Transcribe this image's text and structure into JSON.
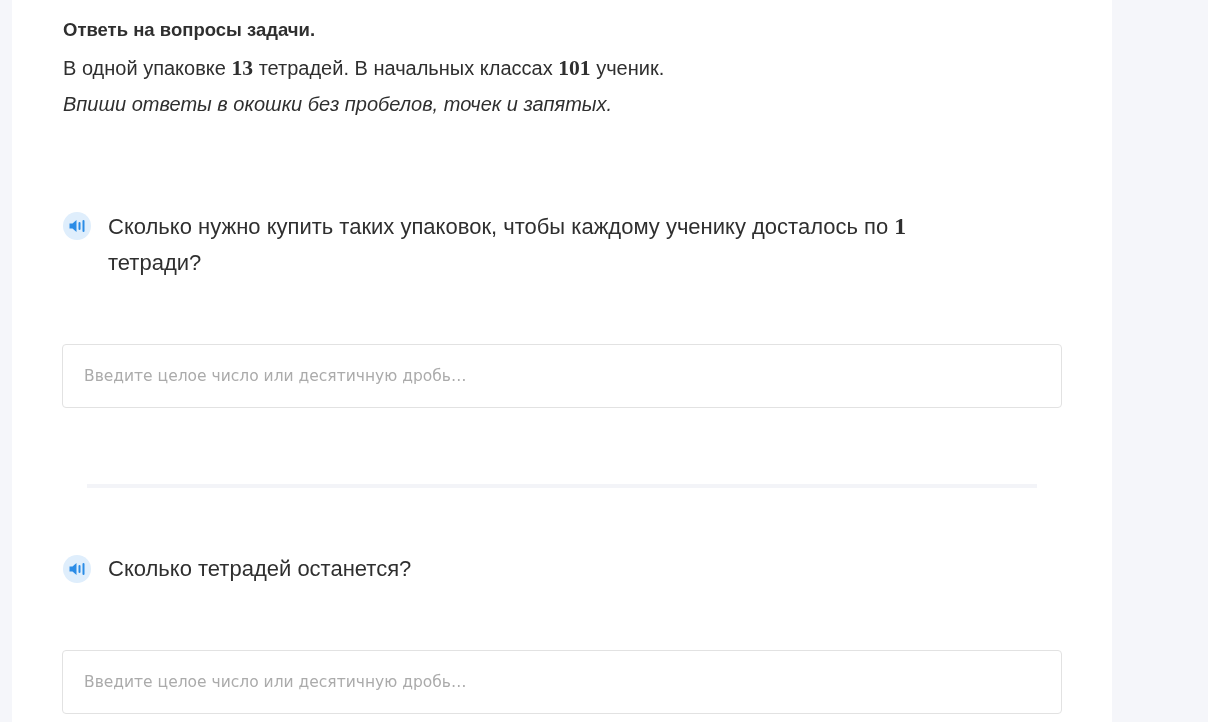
{
  "task": {
    "title": "Ответь на вопросы задачи.",
    "condition": "В одной упаковке **13** тетрадей. В начальных классах **101** ученик.",
    "instruction": "Впиши ответы в окошки без пробелов, точек и запятых."
  },
  "questions": [
    {
      "text": "Сколько нужно купить таких упаковок, чтобы каждому ученику досталось по **1** тетради?",
      "answer": {
        "placeholder": "Введите целое число или десятичную дробь…"
      }
    },
    {
      "text": "Сколько тетрадей останется?",
      "answer": {
        "placeholder": "Введите целое число или десятичную дробь…"
      }
    }
  ]
}
